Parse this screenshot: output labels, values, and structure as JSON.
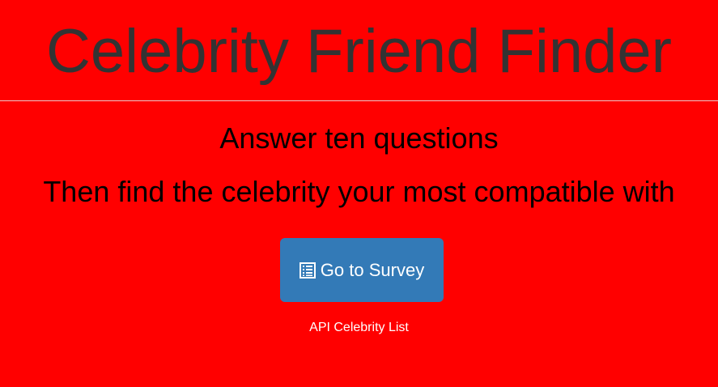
{
  "header": {
    "title": "Celebrity Friend Finder"
  },
  "main": {
    "line1": "Answer ten questions",
    "line2": "Then find the celebrity your most compatible with",
    "survey_button": {
      "label": "Go to Survey",
      "icon": "list-alt-icon"
    },
    "api_link": "API Celebrity List"
  },
  "colors": {
    "background": "#ff0000",
    "button": "#337ab7",
    "title": "#333333"
  }
}
